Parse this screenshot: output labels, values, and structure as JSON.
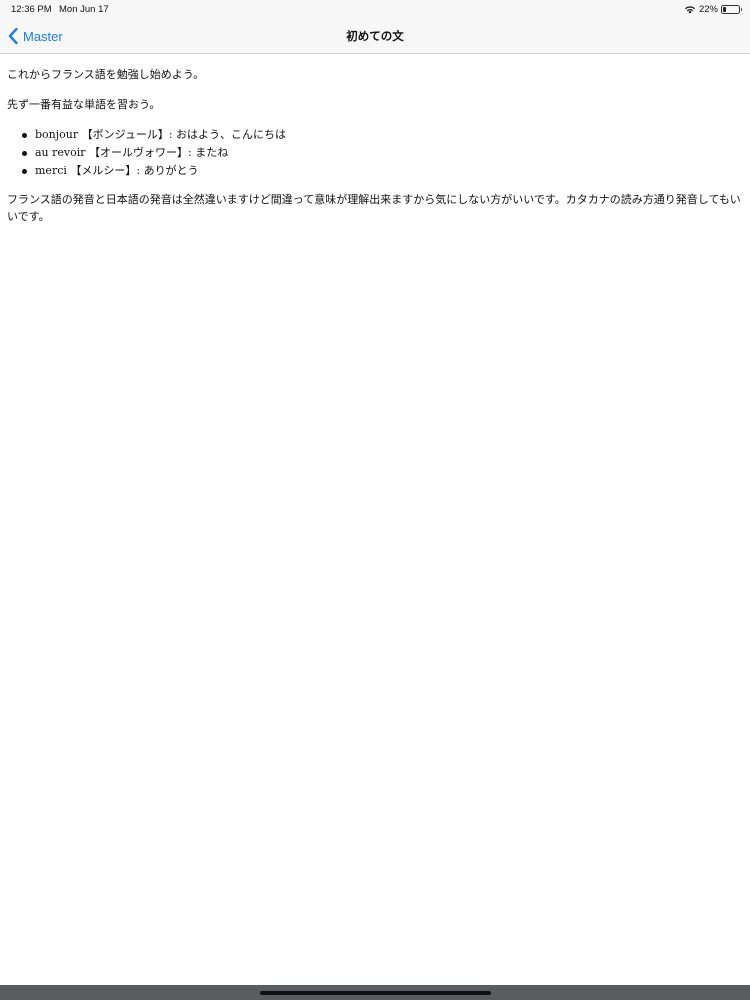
{
  "status_bar": {
    "time": "12:36 PM",
    "date": "Mon Jun 17",
    "wifi_icon": "wifi-icon",
    "battery_percent": "22%",
    "battery_level": 0.22,
    "battery_icon": "battery-icon"
  },
  "nav": {
    "back_icon": "chevron-left-icon",
    "back_label": "Master",
    "title": "初めての文",
    "accent_color": "#1a7cf4"
  },
  "content": {
    "paragraph_1": "これからフランス語を勉強し始めよう。",
    "paragraph_2": "先ず一番有益な単語を習おう。",
    "list_items": [
      "bonjour 【ボンジュール】: おはよう、こんにちは",
      "au revoir 【オールヴォワー】: またね",
      "merci 【メルシー】: ありがとう"
    ],
    "paragraph_3": "フランス語の発音と日本語の発音は全然違いますけど間違って意味が理解出来ますから気にしない方がいいです。カタカナの読み方通り発音してもいいです。"
  }
}
